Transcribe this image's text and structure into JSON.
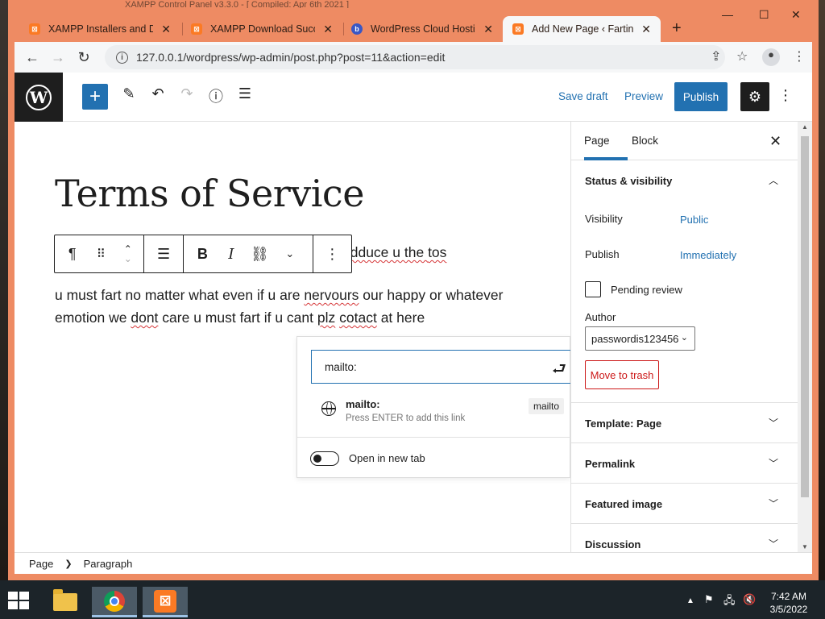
{
  "browser": {
    "background_window_title": "XAMPP Control Panel v3.3.0 - [ Compiled: Apr 6th 2021 ]",
    "tabs": [
      {
        "title": "XAMPP Installers and Do",
        "favicon": "xampp-icon",
        "active": false
      },
      {
        "title": "XAMPP Download Succe",
        "favicon": "xampp-icon",
        "active": false
      },
      {
        "title": "WordPress Cloud Hosting",
        "favicon": "bluehost-icon",
        "active": false
      },
      {
        "title": "Add New Page ‹ Farting T",
        "favicon": "xampp-icon",
        "active": true
      }
    ],
    "url": "127.0.0.1/wordpress/wp-admin/post.php?post=11&action=edit"
  },
  "editor": {
    "header": {
      "save_draft": "Save draft",
      "preview": "Preview",
      "publish": "Publish"
    },
    "title": "Terms of Service",
    "paragraphs": {
      "p1_visible": "odduce u the ",
      "p1_word": "tos",
      "p2_line1_a": "u must fart no matter what even if u are ",
      "p2_line1_b": "nervours",
      "p2_line1_c": " our happy or whatever",
      "p2_line2_a": "emotion we ",
      "p2_line2_b": "dont",
      "p2_line2_c": " care u must fart if u cant ",
      "p2_line2_d": "plz",
      "p2_line2_e": " ",
      "p2_line2_f": "cotact",
      "p2_line2_g": " at here"
    },
    "link_popover": {
      "input_value": "mailto:",
      "suggestion_title": "mailto:",
      "suggestion_hint": "Press ENTER to add this link",
      "suggestion_type": "mailto",
      "open_new_tab_label": "Open in new tab"
    },
    "breadcrumb": [
      "Page",
      "Paragraph"
    ]
  },
  "sidebar": {
    "tabs": [
      "Page",
      "Block"
    ],
    "status_visibility": {
      "title": "Status & visibility",
      "visibility_label": "Visibility",
      "visibility_value": "Public",
      "publish_label": "Publish",
      "publish_value": "Immediately",
      "pending_review_label": "Pending review",
      "author_label": "Author",
      "author_value": "passwordis123456",
      "move_to_trash": "Move to trash"
    },
    "panels": [
      "Template: Page",
      "Permalink",
      "Featured image",
      "Discussion"
    ]
  },
  "taskbar": {
    "time": "7:42 AM",
    "date": "3/5/2022"
  },
  "colors": {
    "accent": "#2271b1",
    "browser_frame": "#ee8b63",
    "danger": "#cc1818"
  }
}
